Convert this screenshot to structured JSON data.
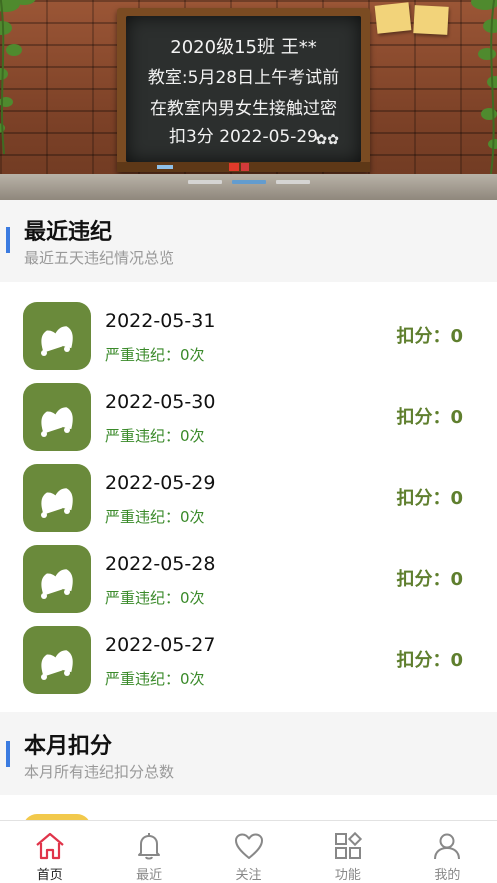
{
  "banner": {
    "line1": "2020级15班 王**",
    "line2": "教室:5月28日上午考试前",
    "line3": "在教室内男女生接触过密",
    "line4": "扣3分 2022-05-29",
    "slides": 3,
    "active_slide": 2
  },
  "recent": {
    "title": "最近违纪",
    "subtitle": "最近五天违纪情况总览",
    "items": [
      {
        "date": "2022-05-31",
        "sub": "严重违纪：0次",
        "score": "扣分：0"
      },
      {
        "date": "2022-05-30",
        "sub": "严重违纪：0次",
        "score": "扣分：0"
      },
      {
        "date": "2022-05-29",
        "sub": "严重违纪：0次",
        "score": "扣分：0"
      },
      {
        "date": "2022-05-28",
        "sub": "严重违纪：0次",
        "score": "扣分：0"
      },
      {
        "date": "2022-05-27",
        "sub": "严重违纪：0次",
        "score": "扣分：0"
      }
    ]
  },
  "month": {
    "title": "本月扣分",
    "subtitle": "本月所有违纪扣分总数"
  },
  "tabs": [
    {
      "label": "首页",
      "icon": "home-icon",
      "active": true
    },
    {
      "label": "最近",
      "icon": "bell-icon",
      "active": false
    },
    {
      "label": "关注",
      "icon": "heart-icon",
      "active": false
    },
    {
      "label": "功能",
      "icon": "grid-icon",
      "active": false
    },
    {
      "label": "我的",
      "icon": "user-icon",
      "active": false
    }
  ],
  "colors": {
    "accent_bar": "#3b7be0",
    "icon_bg": "#6a8a3b",
    "sub_text": "#3a8a2a",
    "score_text": "#5f7f2e",
    "home_active": "#e0344a"
  }
}
